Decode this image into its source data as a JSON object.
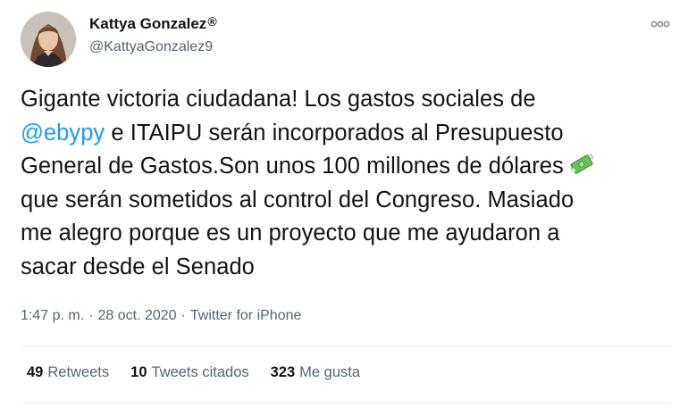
{
  "author": {
    "display_name": "Kattya Gonzalez",
    "reg_mark": "®",
    "handle": "@KattyaGonzalez9",
    "avatar_icon": "profile-photo"
  },
  "menu": {
    "icon": "more-options-icon"
  },
  "tweet": {
    "lines": [
      "Gigante victoria ciudadana! Los gastos sociales de",
      {
        "mention": "@ebypy",
        "rest": " e ITAIPU serán incorporados al Presupuesto"
      },
      "General de Gastos.Son unos 100 millones de dólares",
      "que serán sometidos al control del Congreso. Masiado",
      "me alegro porque es un proyecto que me ayudaron a",
      "sacar desde el Senado"
    ],
    "line1": "Gigante victoria ciudadana! Los gastos sociales de",
    "mention": "@ebypy",
    "line2_rest": " e ITAIPU serán incorporados al Presupuesto",
    "line3": "General de Gastos.Son unos 100 millones de dólares",
    "emoji_icon": "money-with-wings-emoji",
    "line4": "que serán sometidos al control del Congreso. Masiado",
    "line5": "me alegro porque es un proyecto que me ayudaron a",
    "line6": "sacar desde el Senado"
  },
  "meta": {
    "time": "1:47 p. m.",
    "separator": "·",
    "date": "28 oct. 2020",
    "source": "Twitter for iPhone"
  },
  "stats": {
    "retweets_count": "49",
    "retweets_label": "Retweets",
    "quotes_count": "10",
    "quotes_label": "Tweets citados",
    "likes_count": "323",
    "likes_label": "Me gusta"
  },
  "colors": {
    "link": "#1d9bf0",
    "text": "#0f1419",
    "secondary": "#536471",
    "divider": "#e6ecf0"
  }
}
